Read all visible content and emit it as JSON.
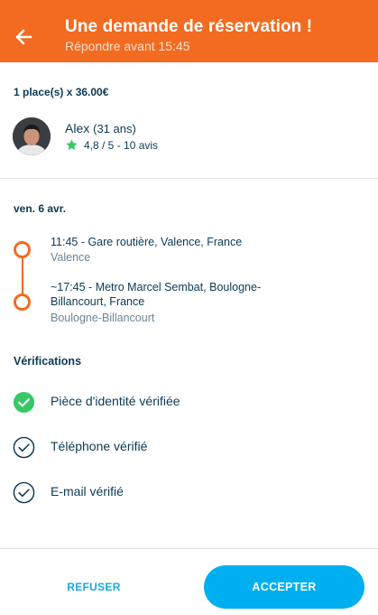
{
  "header": {
    "title": "Une demande de réservation !",
    "subtitle": "Répondre avant 15:45",
    "back_icon": "arrow-left-icon",
    "color": "#f26b21"
  },
  "booking": {
    "seats_price": "1 place(s) x 36.00€"
  },
  "driver": {
    "name": "Alex",
    "age": "(31 ans)",
    "rating": "4,8 / 5 - 10 avis",
    "star_icon": "star-icon",
    "star_color": "#36c767"
  },
  "trip": {
    "date": "ven. 6 avr.",
    "departure": {
      "line": "11:45 - Gare routière, Valence, France",
      "city": "Valence"
    },
    "arrival": {
      "line": "~17:45 - Metro Marcel Sembat, Boulogne-Billancourt, France",
      "city": "Boulogne-Billancourt"
    },
    "route_color": "#f26b21"
  },
  "verifications": {
    "title": "Vérifications",
    "items": [
      {
        "label": "Pièce d'identité vérifiée",
        "icon": "check-circle-filled-icon"
      },
      {
        "label": "Téléphone vérifié",
        "icon": "check-circle-outline-icon"
      },
      {
        "label": "E-mail vérifié",
        "icon": "check-circle-outline-icon"
      }
    ]
  },
  "actions": {
    "refuse_label": "REFUSER",
    "accept_label": "ACCEPTER",
    "accent_color": "#00aff0"
  }
}
